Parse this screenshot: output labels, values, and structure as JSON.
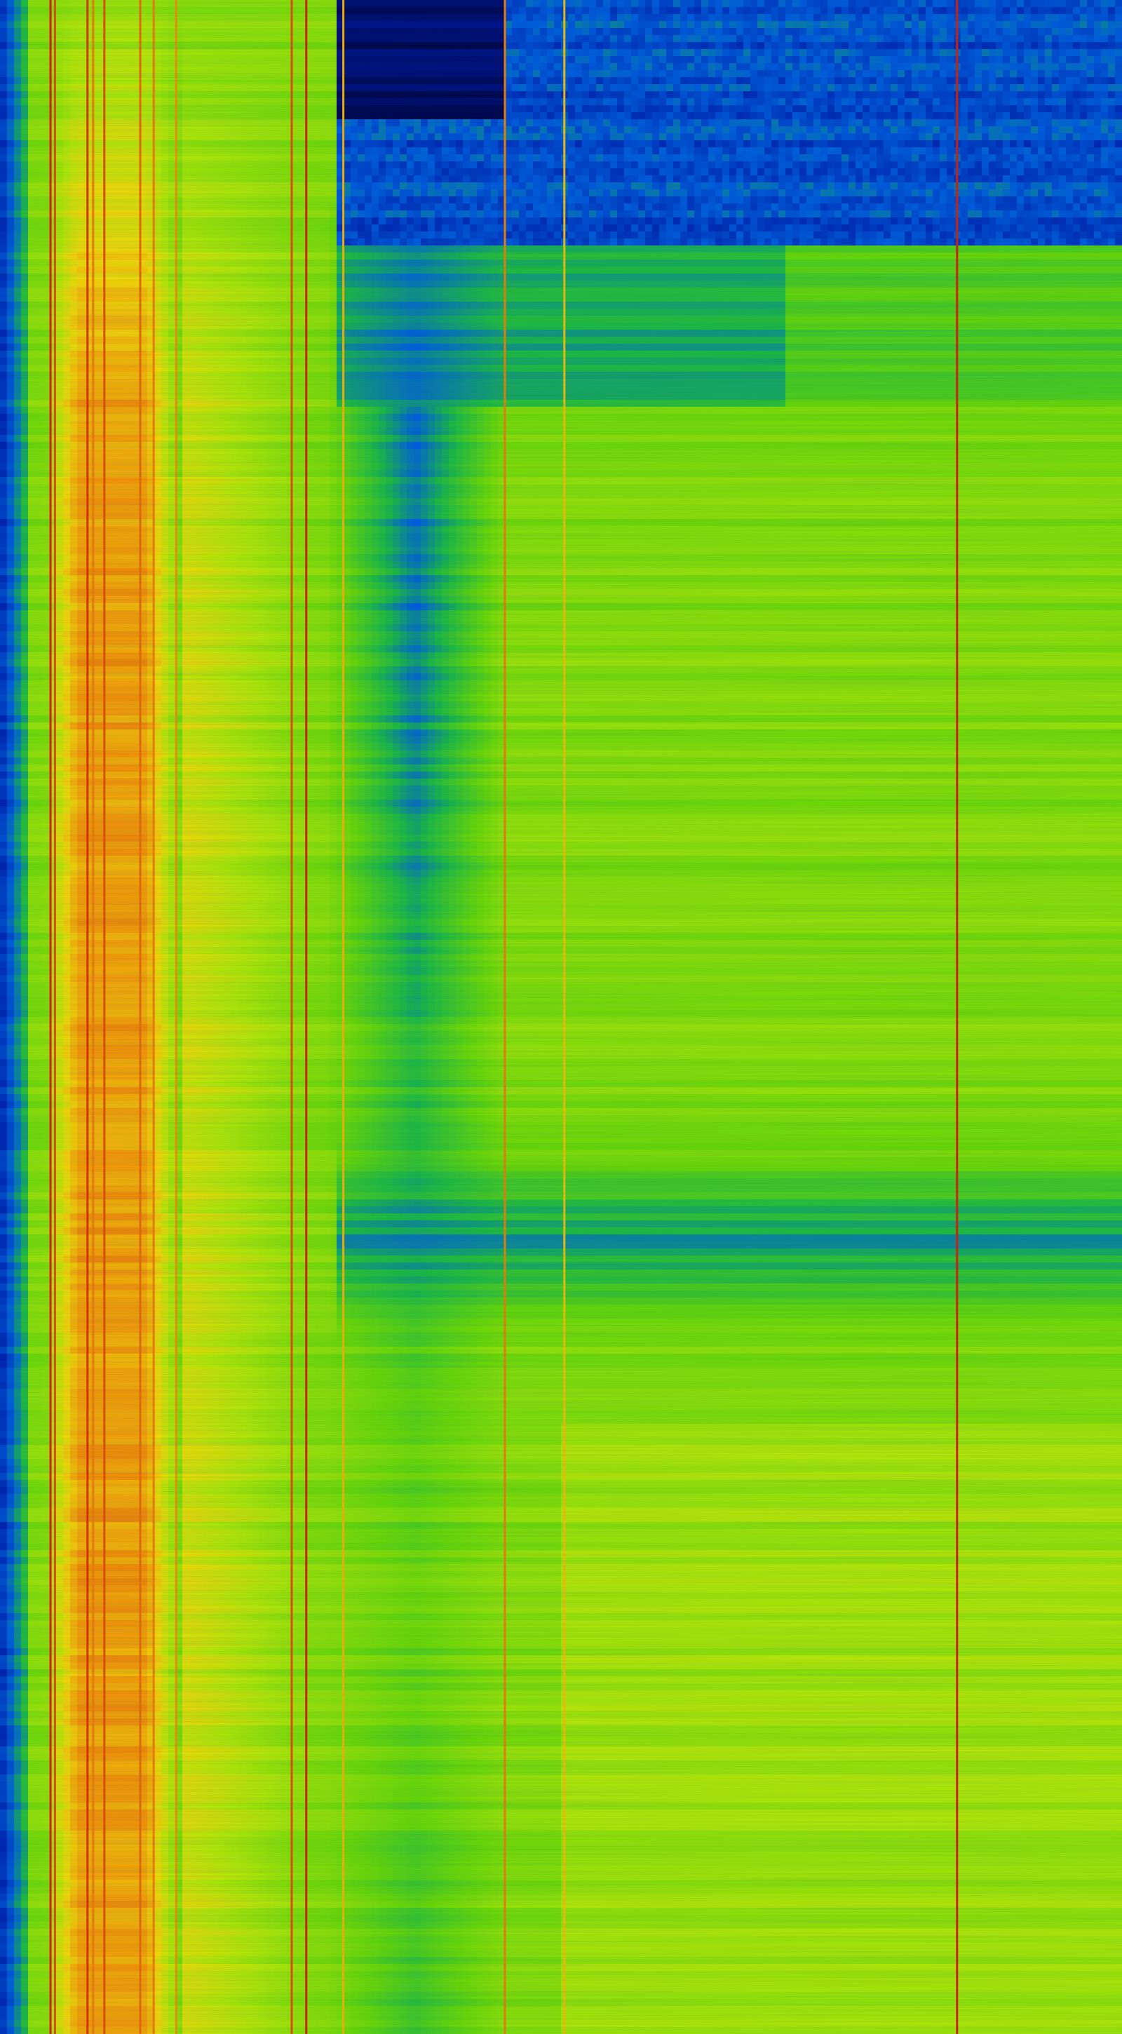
{
  "chart_data": {
    "type": "heatmap",
    "title": "",
    "xlabel": "",
    "ylabel": "",
    "x_range": [
      0,
      1
    ],
    "y_range": [
      0,
      1
    ],
    "grid": false,
    "legend": "none",
    "colormap": [
      "#000033",
      "#0018a8",
      "#0060e0",
      "#20c040",
      "#6ee000",
      "#b8f000",
      "#ffe000",
      "#ff9a00",
      "#e02000"
    ],
    "background_levels": {
      "base": 0.55,
      "low_band_level": 0.85,
      "low_band_range": [
        0.04,
        0.16
      ],
      "top_blue_region": {
        "x": [
          0.3,
          1.0
        ],
        "y": [
          0.0,
          0.12
        ],
        "level": 0.18
      },
      "top_dark_region": {
        "x": [
          0.3,
          0.45
        ],
        "y": [
          0.0,
          0.06
        ],
        "level": 0.05
      },
      "valley_column": {
        "x_center": 0.37,
        "width": 0.08,
        "level": 0.28
      },
      "mid_blue_band": {
        "y": [
          0.56,
          0.66
        ],
        "level": 0.32
      },
      "upper_band": {
        "y": [
          0.12,
          0.2
        ],
        "level": 0.36
      }
    },
    "vertical_lines": [
      {
        "x": 0.045,
        "level": 1.0
      },
      {
        "x": 0.049,
        "level": 0.95
      },
      {
        "x": 0.078,
        "level": 0.98
      },
      {
        "x": 0.083,
        "level": 0.9
      },
      {
        "x": 0.093,
        "level": 0.95
      },
      {
        "x": 0.125,
        "level": 0.92
      },
      {
        "x": 0.137,
        "level": 0.9
      },
      {
        "x": 0.157,
        "level": 0.88
      },
      {
        "x": 0.26,
        "level": 0.95
      },
      {
        "x": 0.273,
        "level": 1.0
      },
      {
        "x": 0.306,
        "level": 0.82
      },
      {
        "x": 0.45,
        "level": 0.9
      },
      {
        "x": 0.503,
        "level": 0.8
      },
      {
        "x": 0.853,
        "level": 1.0
      }
    ]
  }
}
